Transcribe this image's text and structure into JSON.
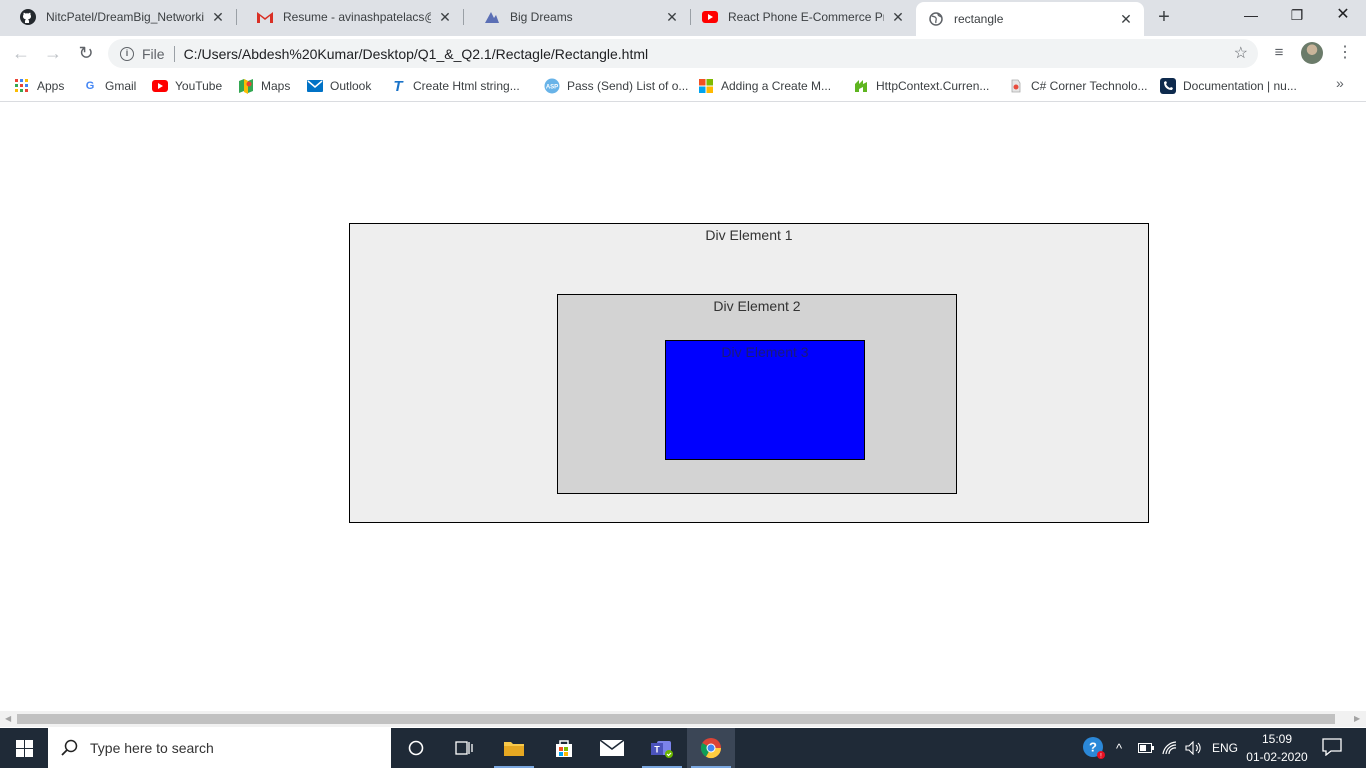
{
  "tabs": [
    {
      "title": "NitcPatel/DreamBig_Networkin",
      "icon": "github-icon"
    },
    {
      "title": "Resume - avinashpatelacs@gm",
      "icon": "gmail-icon"
    },
    {
      "title": "Big Dreams",
      "icon": "big-dreams-icon"
    },
    {
      "title": "React Phone E-Commerce Proj",
      "icon": "youtube-icon"
    },
    {
      "title": "rectangle",
      "icon": "globe-icon",
      "active": true
    }
  ],
  "toolbar": {
    "scheme_label": "File",
    "url": "C:/Users/Abdesh%20Kumar/Desktop/Q1_&_Q2.1/Rectagle/Rectangle.html"
  },
  "bookmarks": [
    {
      "label": "Apps",
      "icon": "apps-grid-icon"
    },
    {
      "label": "Gmail",
      "icon": "google-icon"
    },
    {
      "label": "YouTube",
      "icon": "youtube-icon"
    },
    {
      "label": "Maps",
      "icon": "maps-icon"
    },
    {
      "label": "Outlook",
      "icon": "outlook-icon"
    },
    {
      "label": "Create Html string...",
      "icon": "t-logo-icon"
    },
    {
      "label": "Pass (Send) List of o...",
      "icon": "asp-icon"
    },
    {
      "label": "Adding a Create M...",
      "icon": "microsoft-icon"
    },
    {
      "label": "HttpContext.Curren...",
      "icon": "green-logo-icon"
    },
    {
      "label": "C# Corner Technolo...",
      "icon": "csharp-corner-icon"
    },
    {
      "label": "Documentation | nu...",
      "icon": "phone-icon"
    }
  ],
  "page": {
    "div1_label": "Div Element 1",
    "div2_label": "Div Element 2",
    "div3_label": "Div Element 3",
    "colors": {
      "div1": "#eeeeee",
      "div2": "#d3d3d3",
      "div3": "#0000ff"
    }
  },
  "taskbar": {
    "search_placeholder": "Type here to search",
    "language": "ENG",
    "time": "15:09",
    "date": "01-02-2020"
  }
}
